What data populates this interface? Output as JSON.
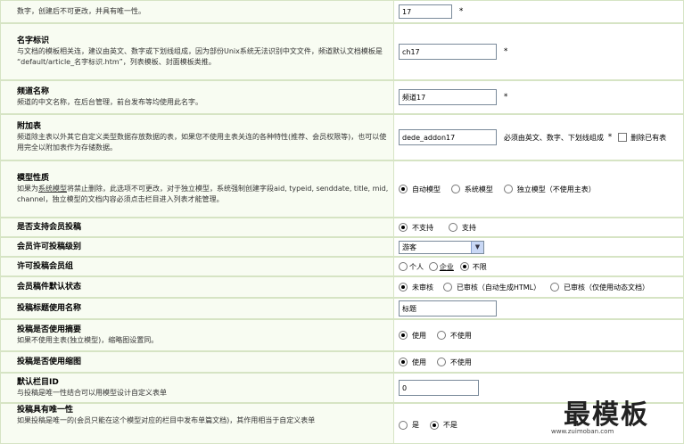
{
  "rows": [
    {
      "id": "channel-id",
      "title": "",
      "desc": "数字，创建后不可更改，并具有唯一性。",
      "value": "17",
      "required": "*"
    },
    {
      "id": "name-id",
      "title": "名字标识",
      "desc": "与文档的模板相关连，建议由英文、数字或下划线组成，因为部份Unix系统无法识别中文文件，频道默认文档模板是 “default/article_名字标识.htm”，列表模板、封面模板类推。",
      "value": "ch17",
      "required": "*"
    },
    {
      "id": "channel-name",
      "title": "频道名称",
      "desc": "频道的中文名称，在后台管理，前台发布等均使用此名字。",
      "value": "频道17",
      "required": "*"
    },
    {
      "id": "addon-table",
      "title": "附加表",
      "desc": "频道除主表以外其它自定义类型数据存放数据的表，如果您不使用主表关连的各种特性(推荐、会员权限等)，也可以使用完全以附加表作为存储数据。",
      "value": "dede_addon17",
      "hint": "必须由英文、数字、下划线组成",
      "required": "*",
      "checkbox_label": "删除已有表"
    },
    {
      "id": "model-type",
      "title": "模型性质",
      "desc_prefix": "如果为",
      "desc_link": "系统模型",
      "desc_suffix": "将禁止删除，此选项不可更改，对于独立模型，系统强制创建字段aid, typeid, senddate, title, mid, channel，独立模型的文档内容必须点击栏目进入列表才能管理。",
      "options": [
        "自动模型",
        "系统模型",
        "独立模型（不使用主表）"
      ],
      "selected": 0
    },
    {
      "id": "member-submit",
      "title": "是否支持会员投稿",
      "options": [
        "不支持",
        "支持"
      ],
      "selected": 0
    },
    {
      "id": "member-level",
      "title": "会员许可投稿级别",
      "select_value": "游客"
    },
    {
      "id": "member-group",
      "title": "许可投稿会员组",
      "options": [
        "个人",
        "企业",
        "不限"
      ],
      "selected": 2
    },
    {
      "id": "default-status",
      "title": "会员稿件默认状态",
      "options": [
        "未审核",
        "已审核（自动生成HTML）",
        "已审核（仅使用动态文档）"
      ],
      "selected": 0
    },
    {
      "id": "title-name",
      "title": "投稿标题使用名称",
      "value": "标题"
    },
    {
      "id": "use-summary",
      "title": "投稿是否使用摘要",
      "desc": "如果不使用主表(独立模型)，缩略图设置同。",
      "options": [
        "使用",
        "不使用"
      ],
      "selected": 0
    },
    {
      "id": "use-thumb",
      "title": "投稿是否使用缩图",
      "options": [
        "使用",
        "不使用"
      ],
      "selected": 0
    },
    {
      "id": "default-column",
      "title": "默认栏目ID",
      "desc": "与投稿是唯一性结合可以用模型设计自定义表单",
      "value": "0"
    },
    {
      "id": "unique-submit",
      "title": "投稿具有唯一性",
      "desc": "如果投稿是唯一的(会员只能在这个模型对应的栏目中发布单篇文档)，其作用相当于自定义表单",
      "options": [
        "是",
        "不是"
      ],
      "selected": 1
    }
  ],
  "watermark": {
    "title": "最模板",
    "url": "www.zuimoban.com"
  },
  "colors": {
    "row_bg": "#f8fcf2",
    "border": "#d6e4c4"
  }
}
